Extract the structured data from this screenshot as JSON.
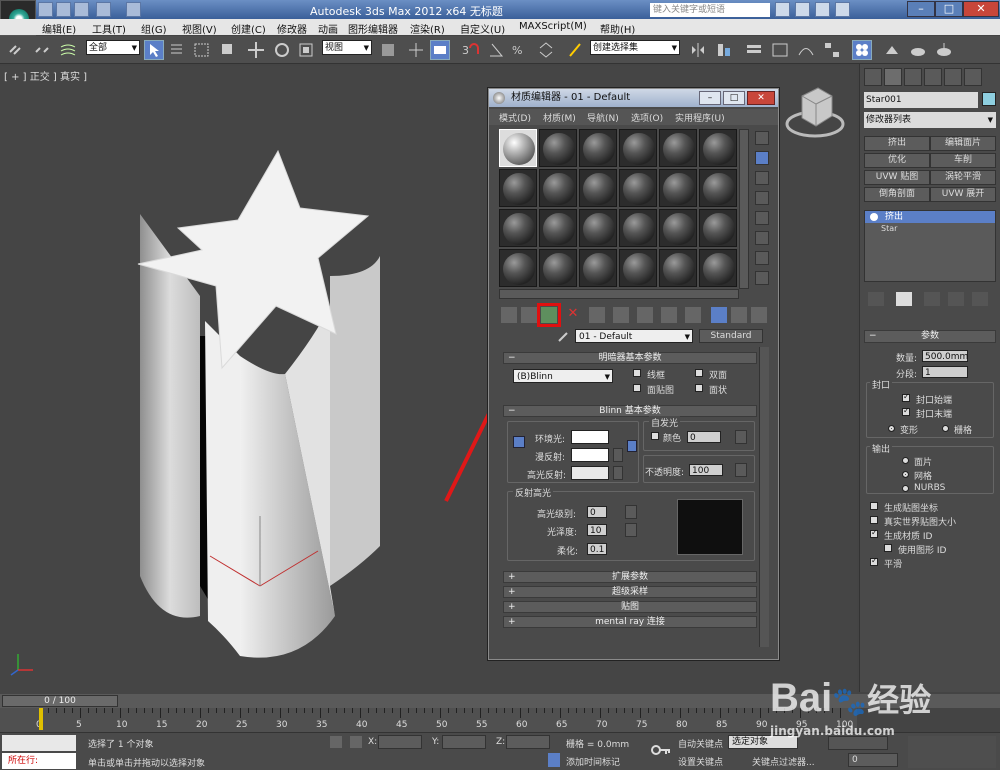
{
  "app": {
    "title": "Autodesk 3ds Max  2012 x64    无标题",
    "search_placeholder": "键入关键字或短语"
  },
  "menubar": [
    "编辑(E)",
    "工具(T)",
    "组(G)",
    "视图(V)",
    "创建(C)",
    "修改器",
    "动画",
    "图形编辑器",
    "渲染(R)",
    "自定义(U)",
    "MAXScript(M)",
    "帮助(H)"
  ],
  "toolbar": {
    "selection_filter": "全部",
    "ref_coord": "视图",
    "named_selection": "创建选择集"
  },
  "viewport": {
    "label": "[ + ] 正交 ] 真实 ]",
    "object_color": "#e8e8e8"
  },
  "material_editor": {
    "title": "材质编辑器 - 01 - Default",
    "menu": [
      "模式(D)",
      "材质(M)",
      "导航(N)",
      "选项(O)",
      "实用程序(U)"
    ],
    "material_name": "01 - Default",
    "material_type": "Standard",
    "shader_rollout": {
      "title": "明暗器基本参数",
      "shader": "(B)Blinn",
      "options": [
        {
          "label": "线框",
          "checked": false
        },
        {
          "label": "双面",
          "checked": false
        },
        {
          "label": "面贴图",
          "checked": false
        },
        {
          "label": "面状",
          "checked": false
        }
      ]
    },
    "blinn_rollout": {
      "title": "Blinn 基本参数",
      "self_illum_group": "自发光",
      "color_label": "颜色",
      "color_value": "0",
      "ambient_label": "环境光:",
      "diffuse_label": "漫反射:",
      "specular_label": "高光反射:",
      "opacity_label": "不透明度:",
      "opacity_value": "100",
      "spec_group": "反射高光",
      "spec_level_label": "高光级别:",
      "spec_level": "0",
      "gloss_label": "光泽度:",
      "gloss": "10",
      "soften_label": "柔化:",
      "soften": "0.1"
    },
    "collapsed_rollouts": [
      "扩展参数",
      "超级采样",
      "贴图",
      "mental ray 连接"
    ]
  },
  "command_panel": {
    "object_name": "Star001",
    "object_color": "#8ecfe0",
    "modifier_list": "修改器列表",
    "buttons": [
      "挤出",
      "编辑面片",
      "优化",
      "车削",
      "UVW 贴图",
      "涡轮平滑",
      "倒角剖面",
      "UVW 展开"
    ],
    "stack": [
      {
        "label": "挤出",
        "selected": true
      },
      {
        "label": "Star",
        "selected": false
      }
    ],
    "params_title": "参数",
    "amount_label": "数量:",
    "amount": "500.0mm",
    "segments_label": "分段:",
    "segments": "1",
    "capping_group": "封口",
    "cap_start": "封口始端",
    "cap_end": "封口末端",
    "morph": "变形",
    "grid": "栅格",
    "output_group": "输出",
    "out_patch": "面片",
    "out_mesh": "网格",
    "out_nurbs": "NURBS",
    "gen_mapping": "生成贴图坐标",
    "real_world": "真实世界贴图大小",
    "gen_mat_ids": "生成材质 ID",
    "use_shape_ids": "使用图形 ID",
    "smooth": "平滑"
  },
  "timeline": {
    "slider": "0 / 100",
    "ticks": [
      "0",
      "5",
      "10",
      "15",
      "20",
      "25",
      "30",
      "35",
      "40",
      "45",
      "50",
      "55",
      "60",
      "65",
      "70",
      "75",
      "80",
      "85",
      "90",
      "95",
      "100"
    ]
  },
  "status": {
    "running": "所在行:",
    "selected": "选择了 1 个对象",
    "hint": "单击或单击并拖动以选择对象",
    "x_label": "X:",
    "y_label": "Y:",
    "z_label": "Z:",
    "grid": "栅格 = 0.0mm",
    "add_time_tag": "添加时间标记",
    "auto_key": "自动关键点",
    "selected_object": "选定对象",
    "set_key": "设置关键点",
    "key_filter": "关键点过滤器...",
    "frame": "0"
  },
  "watermark": {
    "brand": "Bai",
    "brand2": "经验",
    "url": "jingyan.baidu.com"
  }
}
